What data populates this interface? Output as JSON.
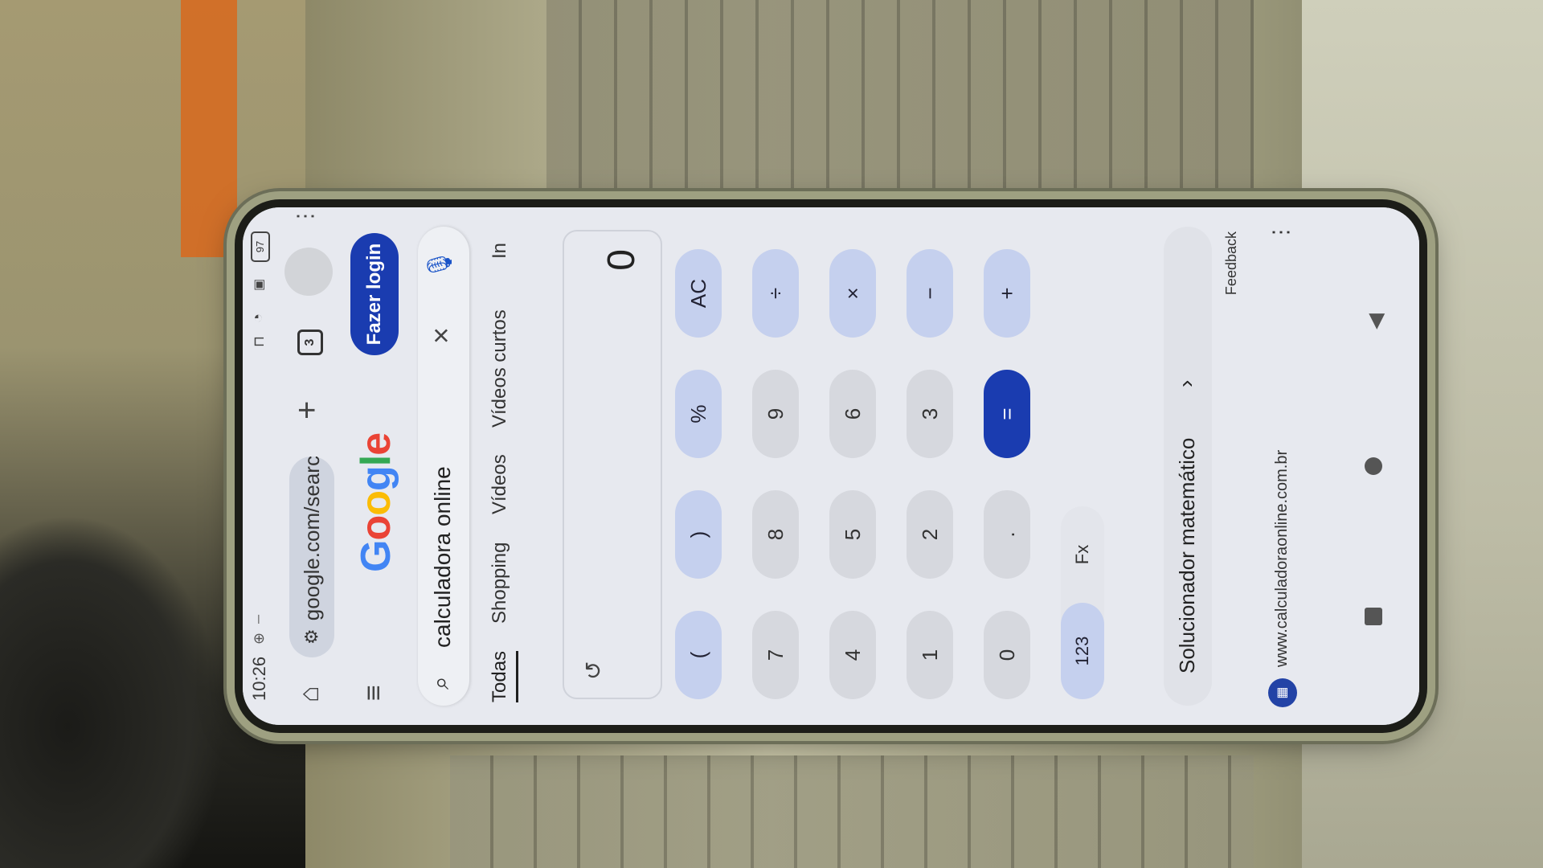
{
  "status_bar": {
    "time": "10:26",
    "battery": "97"
  },
  "browser": {
    "url": "google.com/searc",
    "tab_count": "3"
  },
  "google": {
    "logo_letters": [
      {
        "ch": "G",
        "color": "#4285F4"
      },
      {
        "ch": "o",
        "color": "#EA4335"
      },
      {
        "ch": "o",
        "color": "#FBBC05"
      },
      {
        "ch": "g",
        "color": "#4285F4"
      },
      {
        "ch": "l",
        "color": "#34A853"
      },
      {
        "ch": "e",
        "color": "#EA4335"
      }
    ],
    "login_label": "Fazer login",
    "search_query": "calculadora online",
    "filters": [
      "Todas",
      "Shopping",
      "Vídeos",
      "Vídeos curtos",
      "In"
    ]
  },
  "calculator": {
    "display_value": "0",
    "keys": [
      [
        "(",
        ")",
        "%",
        "AC"
      ],
      [
        "7",
        "8",
        "9",
        "÷"
      ],
      [
        "4",
        "5",
        "6",
        "×"
      ],
      [
        "1",
        "2",
        "3",
        "−"
      ],
      [
        "0",
        ".",
        "=",
        "+"
      ]
    ],
    "modes": [
      "123",
      "Fx"
    ],
    "active_mode": "123"
  },
  "solver": {
    "label": "Solucionador matemático"
  },
  "feedback_label": "Feedback",
  "site_result": {
    "url": "www.calculadoraonline.com.br"
  },
  "colors": {
    "accent": "#1a3cb0",
    "operator_key": "#c5d0ee"
  }
}
